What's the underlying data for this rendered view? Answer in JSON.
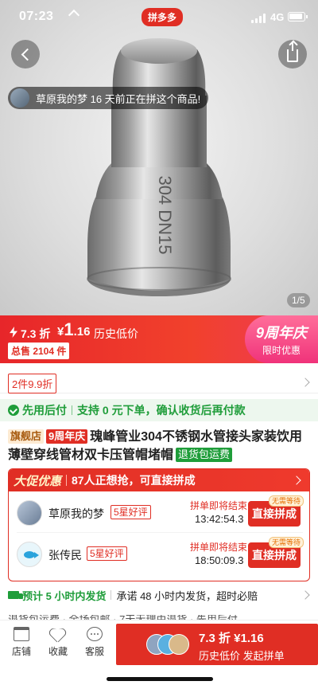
{
  "status_bar": {
    "time": "07:23",
    "network": "4G"
  },
  "brand": "拼多多",
  "colors": {
    "primary_red": "#e02e24",
    "green": "#1f9d3a",
    "anniversary_pink": "#f0337a"
  },
  "hero": {
    "buyer_notice": "草原我的梦 16 天前正在拼这个商品!",
    "engraving": "304 DN15",
    "image_counter": "1/5"
  },
  "price_bar": {
    "discount": "7.3 折",
    "currency": "¥",
    "price_int": "1",
    "price_dec": ".16",
    "history_label": "历史低价",
    "total_sold": "总售 2104 件",
    "anniversary_title": "9周年庆",
    "anniversary_sub": "限时优惠"
  },
  "coupon": {
    "label": "2件9.9折"
  },
  "pay_later": {
    "label": "先用后付",
    "detail": "支持 0 元下单，确认收货后再付款"
  },
  "product": {
    "tag_flagship": "旗舰店",
    "tag_anniversary": "9周年庆",
    "title": "瑰峰管业304不锈钢水管接头家装饮用薄壁穿线管材双卡压管帽堵帽",
    "tag_return": "退货包运费"
  },
  "group_buy": {
    "promo_logo": "大促优惠",
    "header_text": "87人正想抢，可直接拼成",
    "groups": [
      {
        "name": "草原我的梦",
        "rating": "5星好评",
        "status": "拼单即将结束",
        "countdown": "13:42:54.3",
        "wait_badge": "无需等待",
        "join_label": "直接拼成"
      },
      {
        "name": "张传民",
        "rating": "5星好评",
        "status": "拼单即将结束",
        "countdown": "18:50:09.3",
        "wait_badge": "无需等待",
        "join_label": "直接拼成"
      }
    ]
  },
  "shipping": {
    "estimate": "预计 5 小时内发货",
    "promise": "承诺 48 小时内发货，超时必赔"
  },
  "services_partial": "退货包运费 · 全场包邮 · 7天无理由退货 · 先用后付",
  "bottom_bar": {
    "shop": "店铺",
    "favorite": "收藏",
    "service": "客服",
    "buy_price": "7.3 折 ¥1.16",
    "buy_sub": "历史低价 发起拼单"
  }
}
